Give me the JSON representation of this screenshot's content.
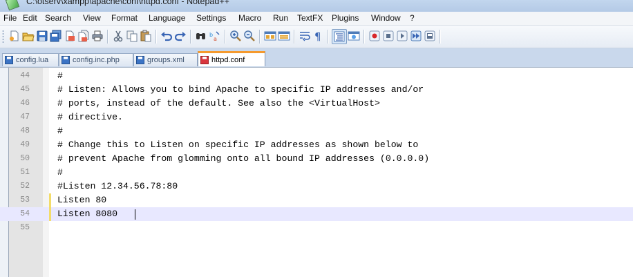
{
  "window": {
    "title": "C:\\otserv\\xampp\\apache\\conf\\httpd.conf - Notepad++"
  },
  "menu": [
    "File",
    "Edit",
    "Search",
    "View",
    "Format",
    "Language",
    "Settings",
    "Macro",
    "Run",
    "TextFX",
    "Plugins",
    "Window",
    "?"
  ],
  "toolbar": {
    "buttons": [
      "new-file-icon",
      "open-file-icon",
      "save-icon",
      "save-all-icon",
      "close-icon",
      "close-all-icon",
      "print-icon",
      "cut-icon",
      "copy-icon",
      "paste-icon",
      "undo-icon",
      "redo-icon",
      "find-icon",
      "replace-icon",
      "zoom-in-icon",
      "zoom-out-icon",
      "sync-vertical-icon",
      "sync-horizontal-icon",
      "word-wrap-icon",
      "show-all-chars-icon",
      "indent-guide-icon",
      "view-icon",
      "record-macro-icon",
      "stop-macro-icon",
      "play-macro-icon",
      "run-macro-multiple-icon",
      "save-macro-icon"
    ]
  },
  "tabs": [
    {
      "label": "config.lua",
      "active": false,
      "icon": "saved-file-icon"
    },
    {
      "label": "config.inc.php",
      "active": false,
      "icon": "saved-file-icon"
    },
    {
      "label": "groups.xml",
      "active": false,
      "icon": "saved-file-icon"
    },
    {
      "label": "httpd.conf",
      "active": true,
      "icon": "modified-file-icon"
    }
  ],
  "editor": {
    "lines": [
      {
        "num": "44",
        "text": "#"
      },
      {
        "num": "45",
        "text": "# Listen: Allows you to bind Apache to specific IP addresses and/or"
      },
      {
        "num": "46",
        "text": "# ports, instead of the default. See also the <VirtualHost>"
      },
      {
        "num": "47",
        "text": "# directive."
      },
      {
        "num": "48",
        "text": "#"
      },
      {
        "num": "49",
        "text": "# Change this to Listen on specific IP addresses as shown below to"
      },
      {
        "num": "50",
        "text": "# prevent Apache from glomming onto all bound IP addresses (0.0.0.0)"
      },
      {
        "num": "51",
        "text": "#"
      },
      {
        "num": "52",
        "text": "#Listen 12.34.56.78:80"
      },
      {
        "num": "53",
        "text": "Listen 80",
        "changed": true
      },
      {
        "num": "54",
        "text": "Listen 8080",
        "changed": true,
        "current": true
      },
      {
        "num": "55",
        "text": ""
      }
    ]
  },
  "colors": {
    "current_line": "#e8e8ff",
    "changed_marker": "#f3dc6a",
    "active_tab_accent": "#f59a2e",
    "line_number": "#8a8a8a"
  }
}
